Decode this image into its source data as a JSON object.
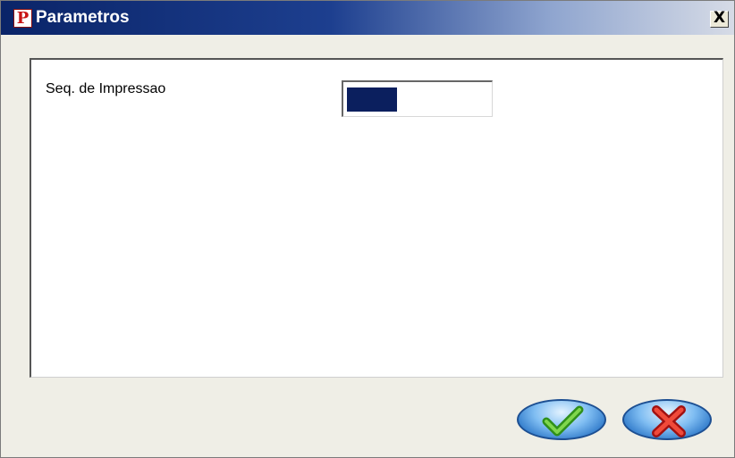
{
  "window": {
    "title": "Parametros",
    "app_icon_letter": "P",
    "close_label": "X"
  },
  "form": {
    "fields": [
      {
        "label": "Seq. de Impressao",
        "value": ""
      }
    ]
  },
  "buttons": {
    "ok_icon": "checkmark-icon",
    "cancel_icon": "x-cross-icon"
  },
  "colors": {
    "titlebar_start": "#0a2468",
    "selection": "#0b1f5e",
    "button_blue": "#2f79c9"
  }
}
